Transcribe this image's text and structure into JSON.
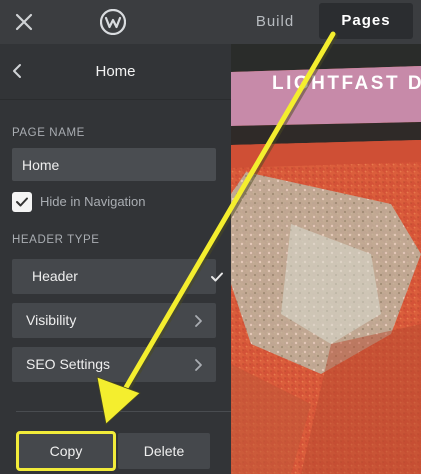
{
  "topbar": {
    "close_icon": "close-icon",
    "logo_icon": "weebly-logo",
    "tabs": [
      {
        "label": "Build",
        "active": false
      },
      {
        "label": "Pages",
        "active": true
      }
    ]
  },
  "sidebar": {
    "back_icon": "chevron-left-icon",
    "title": "Home",
    "page_name_label": "PAGE NAME",
    "page_name_value": "Home",
    "hide_in_nav_label": "Hide in Navigation",
    "hide_in_nav_checked": true,
    "header_type_label": "HEADER TYPE",
    "header_option_label": "Header",
    "visibility_label": "Visibility",
    "seo_label": "SEO Settings",
    "copy_label": "Copy",
    "delete_label": "Delete"
  },
  "canvas": {
    "hero_title": "LIGHTFAST D"
  },
  "colors": {
    "sidebar_bg": "#323437",
    "topbar_bg": "#3b3d40",
    "highlight": "#f2ec3a",
    "annotation_arrow": "#f4ee2e"
  }
}
